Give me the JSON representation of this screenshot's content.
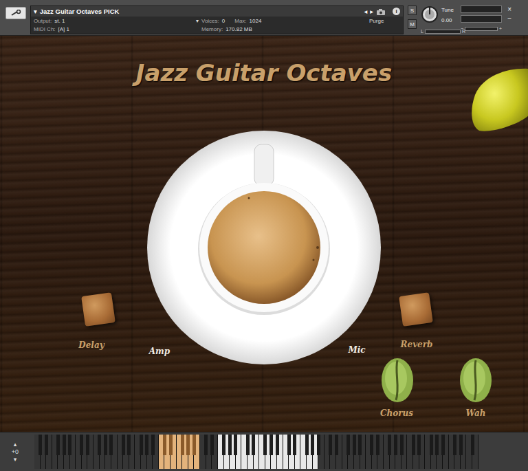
{
  "header": {
    "menu_arrow": "▾",
    "title": "Jazz Guitar Octaves PICK",
    "prev": "◂",
    "next": "▸",
    "info": "i",
    "output_label": "Output:",
    "output": "st. 1",
    "midi_label": "MIDI Ch:",
    "midi": "[A]  1",
    "voices_label": "Voices:",
    "voices": "0",
    "max_label": "Max:",
    "max": "1024",
    "memory_label": "Memory:",
    "memory": "170.82 MB",
    "purge": "Purge",
    "dropdown": "▾",
    "solo": "S",
    "mute": "M",
    "tune_label": "Tune",
    "tune": "0.00",
    "pan_left": "L",
    "pan_right": "R",
    "vol_minus": "−",
    "vol_plus": "+",
    "close": "×",
    "minimize": "−"
  },
  "instrument": {
    "title": "Jazz Guitar Octaves",
    "controls": [
      {
        "label": "Delay",
        "kind": "cube"
      },
      {
        "label": "Amp",
        "kind": "text"
      },
      {
        "label": "Mic",
        "kind": "text"
      },
      {
        "label": "Reverb",
        "kind": "cube"
      },
      {
        "label": "Chorus",
        "kind": "bean"
      },
      {
        "label": "Wah",
        "kind": "bean"
      }
    ]
  },
  "keyboard": {
    "octave": "+0",
    "up": "▴",
    "down": "▾",
    "white_keys": 75,
    "zones": [
      {
        "kind": "keyswitch",
        "from": 21,
        "to": 27
      },
      {
        "kind": "playable",
        "from": 31,
        "to": 47
      }
    ]
  }
}
